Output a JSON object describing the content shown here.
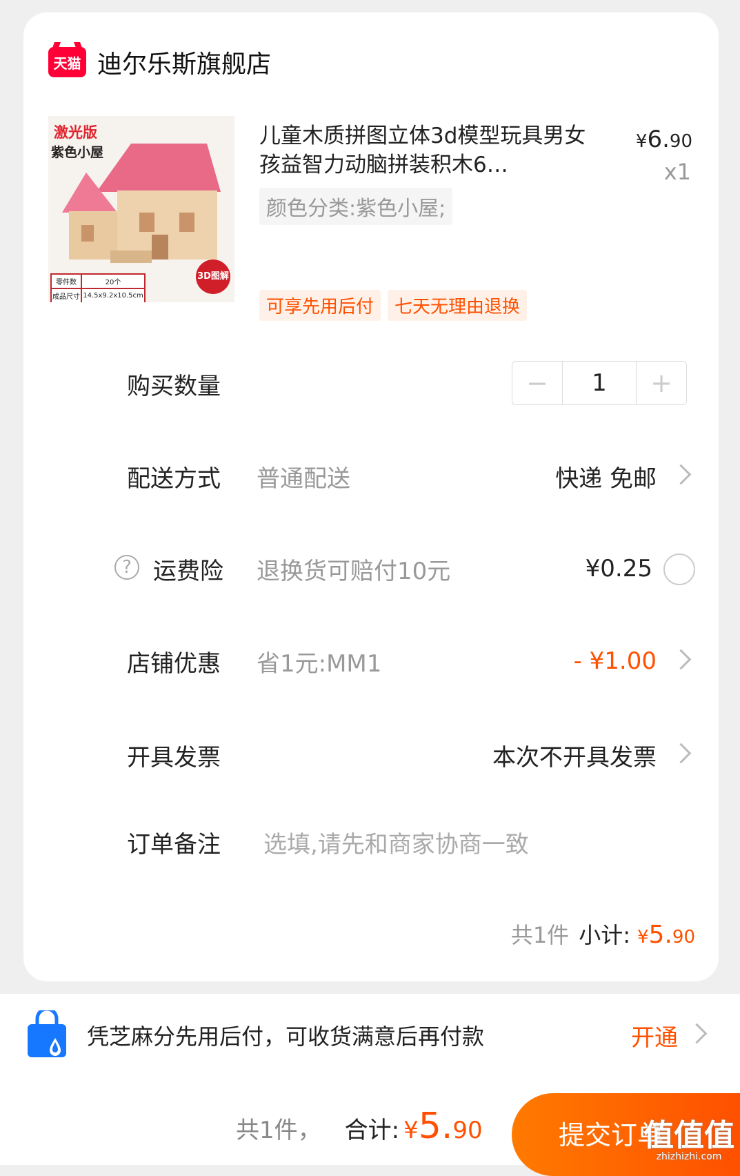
{
  "store": {
    "logo_text": "天猫",
    "name": "迪尔乐斯旗舰店"
  },
  "product": {
    "image_text_1": "激光版",
    "image_text_2": "紫色小屋",
    "image_spec": [
      "零件数",
      "20个",
      "成品尺寸",
      "14.5x9.2x10.5cm"
    ],
    "image_badge": "3D图解",
    "title": "儿童木质拼图立体3d模型玩具男女孩益智力动脑拼装积木6…",
    "price_symbol": "¥",
    "price_int": "6.",
    "price_dec": "90",
    "quantity_label": "x1",
    "sku": "颜色分类:紫色小屋;",
    "tags": [
      "可享先用后付",
      "七天无理由退换"
    ]
  },
  "quantity": {
    "label": "购买数量",
    "value": "1",
    "minus": "−",
    "plus": "+"
  },
  "delivery": {
    "label": "配送方式",
    "sub": "普通配送",
    "value": "快递 免邮"
  },
  "insurance": {
    "help": "?",
    "label": "运费险",
    "sub": "退换货可赔付10元",
    "value": "¥0.25"
  },
  "discount": {
    "label": "店铺优惠",
    "sub": "省1元:MM1",
    "value": "- ¥1.00"
  },
  "invoice": {
    "label": "开具发票",
    "value": "本次不开具发票"
  },
  "note": {
    "label": "订单备注",
    "placeholder": "选填,请先和商家协商一致"
  },
  "subtotal": {
    "count": "共1件",
    "label": "小计:",
    "symbol": "¥",
    "int": "5.",
    "dec": "90"
  },
  "promo": {
    "text": "凭芝麻分先用后付，可收货满意后再付款",
    "action": "开通"
  },
  "footer": {
    "count": "共1件，",
    "total_label": "合计:",
    "symbol": "¥",
    "int": "5.",
    "dec": "90",
    "submit": "提交订单"
  },
  "watermark": {
    "big": "值值值",
    "small": "zhizhizhi.com"
  },
  "colors": {
    "accent": "#ff5000",
    "brand": "#ff0036"
  }
}
